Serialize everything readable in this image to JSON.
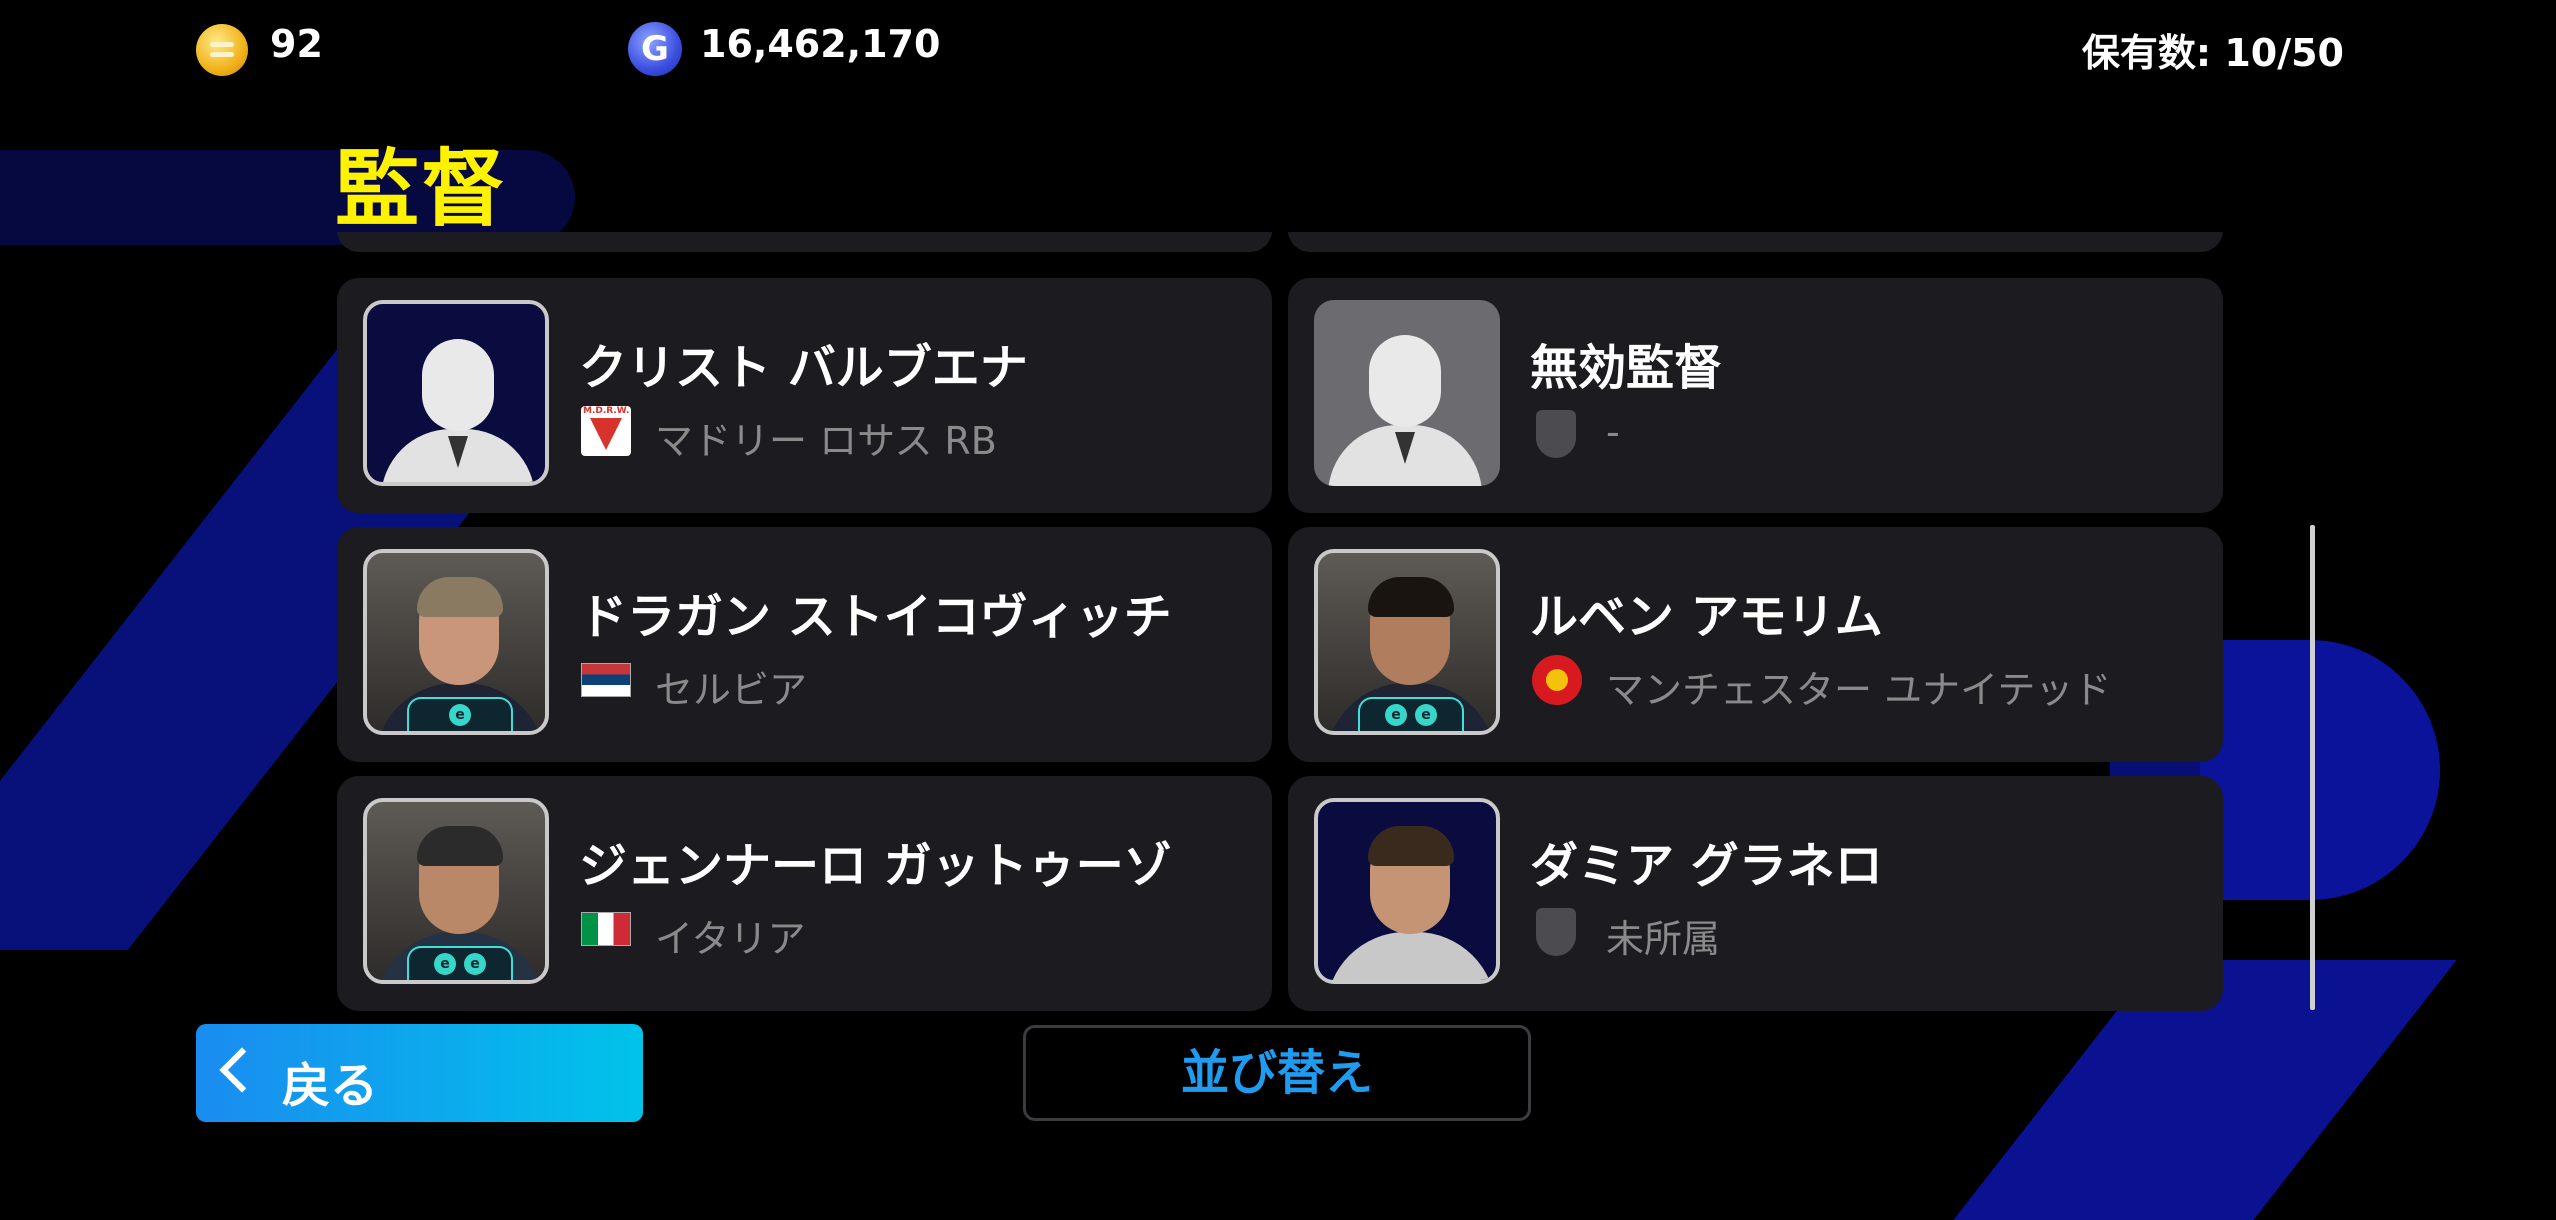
{
  "currency": {
    "coins": "92",
    "gp": "16,462,170"
  },
  "holding": "保有数: 10/50",
  "section_title": "監督",
  "managers": [
    {
      "name": "クリスト バルブエナ",
      "team": "マドリー ロサス RB",
      "team_icon": "mdrw-crest-icon",
      "badges": 0
    },
    {
      "name": "無効監督",
      "team": "-",
      "team_icon": "shield-icon",
      "badges": 0
    },
    {
      "name": "ドラガン ストイコヴィッチ",
      "team": "セルビア",
      "team_icon": "flag-serbia-icon",
      "badges": 1
    },
    {
      "name": "ルベン アモリム",
      "team": "マンチェスター ユナイテッド",
      "team_icon": "man-utd-crest-icon",
      "badges": 2
    },
    {
      "name": "ジェンナーロ ガットゥーゾ",
      "team": "イタリア",
      "team_icon": "flag-italy-icon",
      "badges": 2
    },
    {
      "name": "ダミア グラネロ",
      "team": "未所属",
      "team_icon": "shield-icon",
      "badges": 0
    }
  ],
  "buttons": {
    "back": "戻る",
    "sort": "並び替え"
  },
  "badge_letter": "e",
  "mdrw_text": "M.D.R.W.",
  "gp_letter": "G",
  "colors": {
    "title": "#fff200",
    "back_start": "#1a8cf0",
    "back_end": "#00c3ea",
    "sort_text": "#1f9bf0"
  }
}
